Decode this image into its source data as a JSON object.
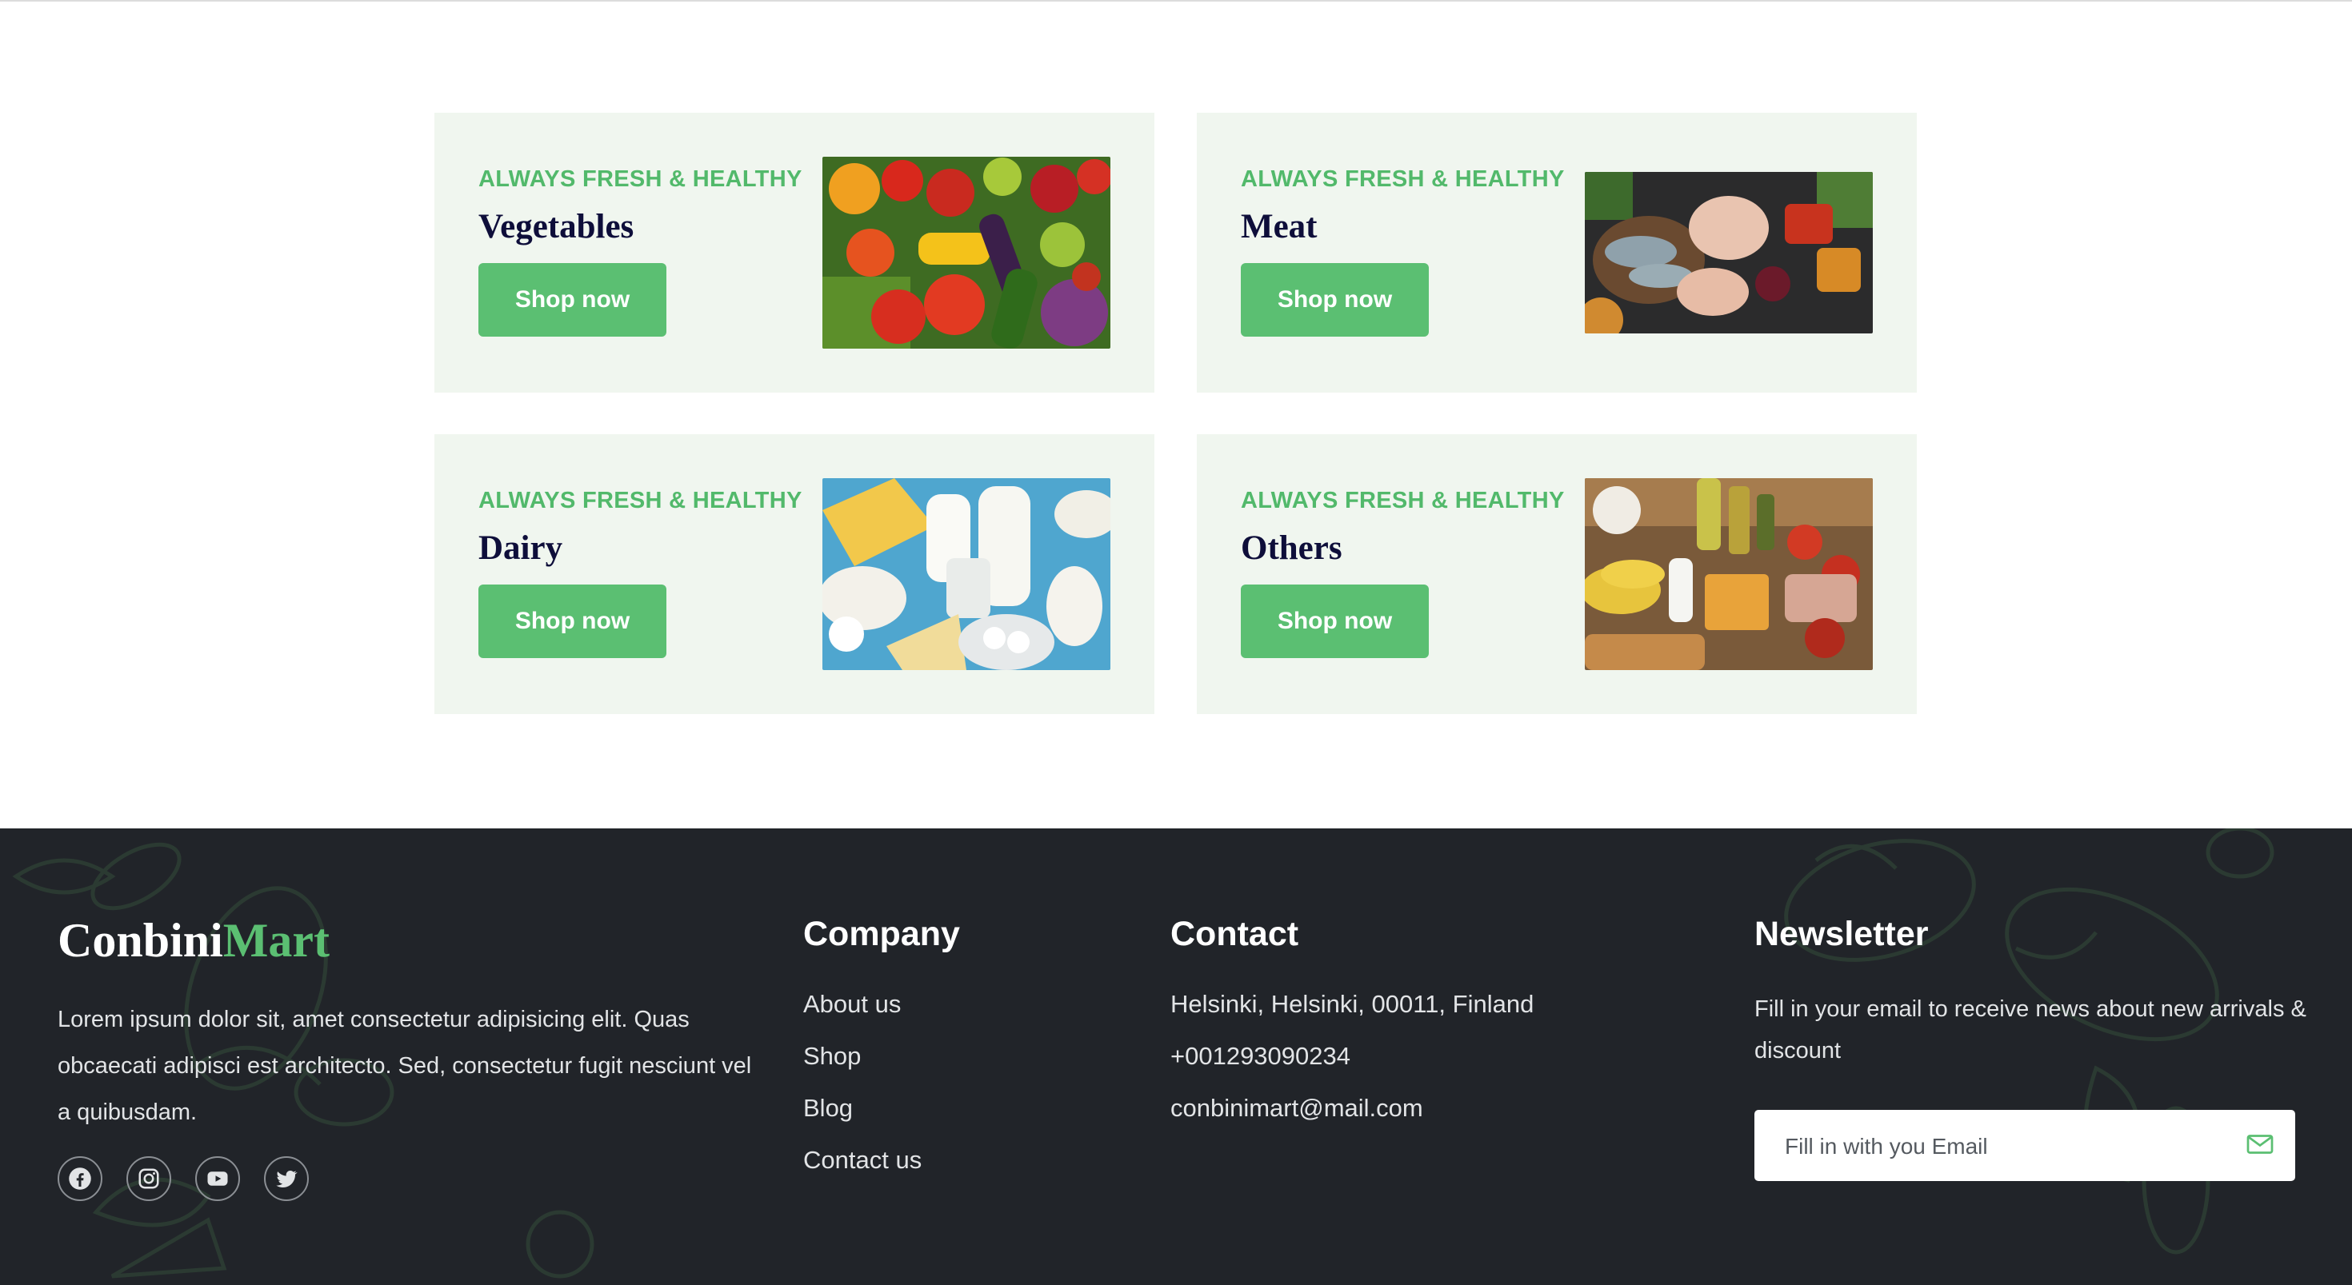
{
  "promos": [
    {
      "eyebrow": "ALWAYS FRESH & HEALTHY",
      "title": "Vegetables",
      "button": "Shop now",
      "image": "vegetables-photo"
    },
    {
      "eyebrow": "ALWAYS FRESH & HEALTHY",
      "title": "Meat",
      "button": "Shop now",
      "image": "meat-photo"
    },
    {
      "eyebrow": "ALWAYS FRESH & HEALTHY",
      "title": "Dairy",
      "button": "Shop now",
      "image": "dairy-photo"
    },
    {
      "eyebrow": "ALWAYS FRESH & HEALTHY",
      "title": "Others",
      "button": "Shop now",
      "image": "groceries-photo"
    }
  ],
  "footer": {
    "brand": {
      "part1": "Conbini",
      "part2": "Mart"
    },
    "about": "Lorem ipsum dolor sit, amet consectetur adipisicing elit. Quas obcaecati adipisci est architecto. Sed, consectetur fugit nesciunt vel a quibusdam.",
    "socials": [
      "facebook-icon",
      "instagram-icon",
      "youtube-icon",
      "twitter-icon"
    ],
    "company": {
      "title": "Company",
      "links": [
        "About us",
        "Shop",
        "Blog",
        "Contact us"
      ]
    },
    "contact": {
      "title": "Contact",
      "address": "Helsinki, Helsinki, 00011, Finland",
      "phone": "+001293090234",
      "email": "conbinimart@mail.com"
    },
    "newsletter": {
      "title": "Newsletter",
      "text": "Fill in your email to receive news about new arrivals & discount",
      "placeholder": "Fill in with you Email",
      "submit_icon": "mail-icon"
    }
  },
  "colors": {
    "accent": "#5bbf72",
    "card_bg": "#f0f6ef",
    "footer_bg": "#212429",
    "heading": "#0e0e3a"
  }
}
